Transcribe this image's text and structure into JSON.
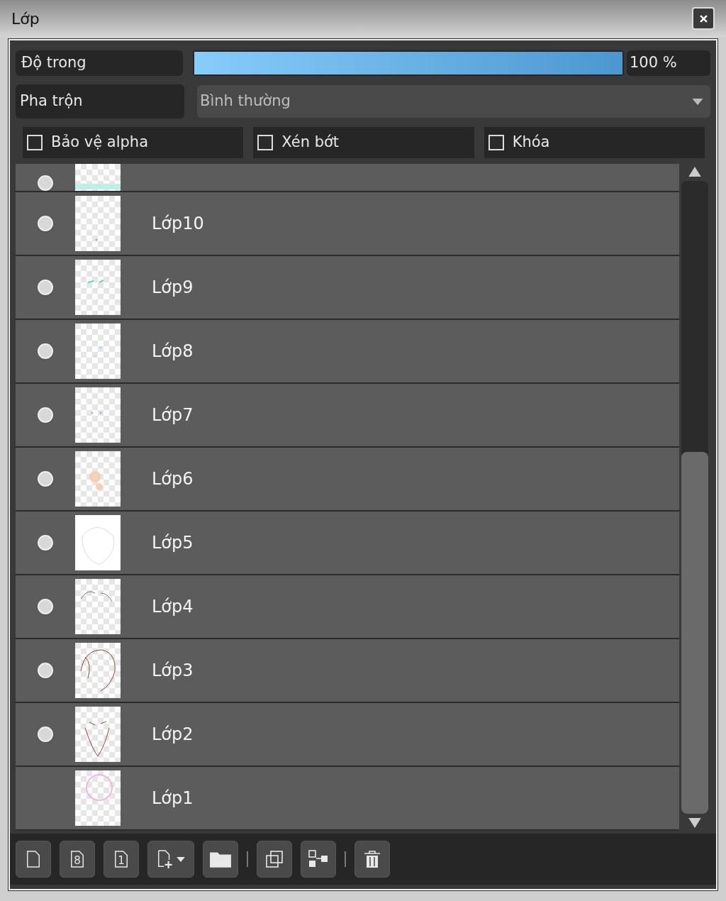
{
  "window": {
    "title": "Lớp"
  },
  "opacity": {
    "label": "Độ trong",
    "level": 1,
    "reading": "100 %"
  },
  "blend": {
    "label": "Pha trộn",
    "value": "Bình thường"
  },
  "options": [
    {
      "label": "Bảo vệ alpha",
      "checked": false
    },
    {
      "label": "Xén bớt",
      "checked": false
    },
    {
      "label": "Khóa",
      "checked": false
    }
  ],
  "layers": [
    {
      "visible": true
    },
    {
      "name": "Lớp10",
      "visible": true
    },
    {
      "name": "Lớp9",
      "visible": true
    },
    {
      "name": "Lớp8",
      "visible": true
    },
    {
      "name": "Lớp7",
      "visible": true
    },
    {
      "name": "Lớp6",
      "visible": true
    },
    {
      "name": "Lớp5",
      "visible": true
    },
    {
      "name": "Lớp4",
      "visible": true
    },
    {
      "name": "Lớp3",
      "visible": true
    },
    {
      "name": "Lớp2",
      "visible": true
    },
    {
      "name": "Lớp1",
      "visible": false
    }
  ],
  "toolbar": [
    {
      "kind": "new"
    },
    {
      "kind": "page",
      "label": "8"
    },
    {
      "kind": "page",
      "label": "1"
    },
    {
      "kind": "add-menu"
    },
    {
      "kind": "folder"
    },
    {
      "kind": "separator"
    },
    {
      "kind": "copy"
    },
    {
      "kind": "merge"
    },
    {
      "kind": "separator"
    },
    {
      "kind": "delete"
    }
  ]
}
